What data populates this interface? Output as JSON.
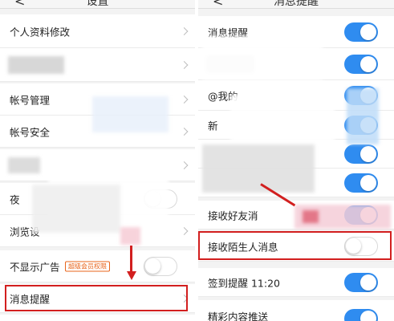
{
  "left_screen": {
    "title": "设置",
    "back_glyph": "<",
    "rows": {
      "profile_edit": "个人资料修改",
      "account_manage": "帐号管理",
      "account_security": "帐号安全",
      "row_partial_4": "夜",
      "browse_settings": "浏览设",
      "hide_ads": "不显示广告",
      "vip_badge": "超级会员权限",
      "notifications": "消息提醒"
    },
    "toggles": {
      "night_mode": "off",
      "hide_ads": "off"
    }
  },
  "right_screen": {
    "title": "消息提醒",
    "back_glyph": "<",
    "rows": {
      "message_alert": "消息提醒",
      "mine": "@我的",
      "new_partial": "新",
      "receive_friend_msg": "接收好友消",
      "receive_stranger_msg": "接收陌生人消息",
      "checkin_reminder": "签到提醒 11:20",
      "featured_push": "精彩内容推送"
    },
    "toggles": {
      "message_alert": "on",
      "row2": "on",
      "mine": "on",
      "new": "on",
      "row5": "on",
      "row6": "on",
      "receive_friend_msg": "on",
      "receive_stranger_msg": "off",
      "checkin_reminder": "on",
      "featured_push": "on"
    }
  },
  "colors": {
    "toggle_on": "#2f8cf0",
    "highlight_red": "#d21f1f",
    "badge_orange": "#e8641b"
  }
}
